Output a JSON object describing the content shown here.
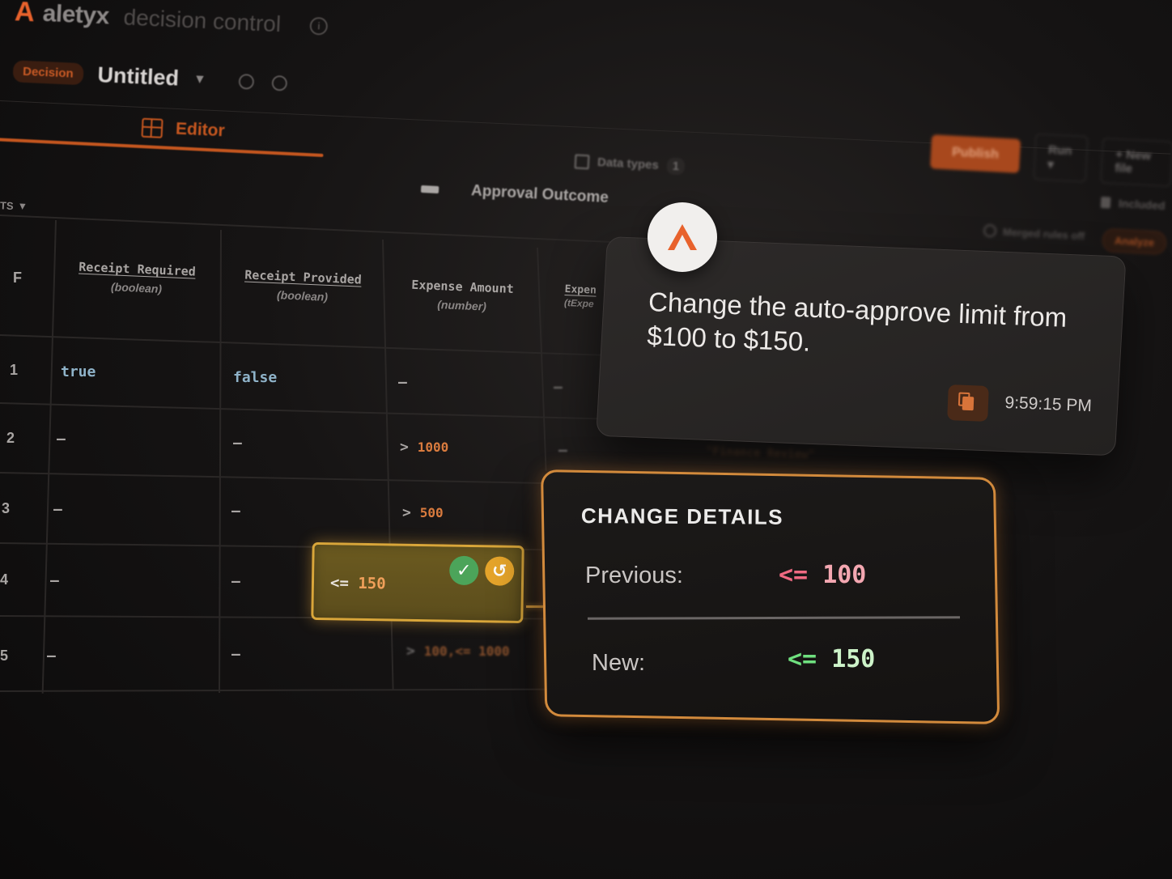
{
  "app": {
    "logo": "A",
    "brand_name": "aletyx",
    "brand_sub": "decision control",
    "info_icon": "info-icon"
  },
  "header": {
    "badge": "Decision",
    "title": "Untitled",
    "tab_editor": "Editor",
    "data_types_label": "Data types",
    "data_types_count": "1",
    "publish_label": "Publish",
    "run_label": "Run",
    "new_file_label": "New file",
    "included_label": "Included",
    "hit_policy_label": "Merged rules off",
    "analyze_label": "Analyze"
  },
  "table": {
    "inputs_toggle": "TS",
    "output_title": "Approval Outcome",
    "hit_col": "F",
    "columns": [
      {
        "name": "Receipt Required",
        "type": "(boolean)"
      },
      {
        "name": "Receipt Provided",
        "type": "(boolean)"
      },
      {
        "name": "Expense Amount",
        "type": "(number)"
      },
      {
        "name": "Expen",
        "type": "(tExpe"
      }
    ],
    "rows": [
      {
        "num": "1",
        "c1": "true",
        "c2": "false",
        "c3_op": "",
        "c3_num": "–",
        "c4": "–"
      },
      {
        "num": "2",
        "c1": "–",
        "c2": "–",
        "c3_op": ">",
        "c3_num": "1000",
        "c4": "–"
      },
      {
        "num": "3",
        "c1": "–",
        "c2": "–",
        "c3_op": ">",
        "c3_num": "500",
        "c4": ""
      },
      {
        "num": "4",
        "c1": "–",
        "c2": "–",
        "c3_op": "",
        "c3_num": "",
        "c4": ""
      },
      {
        "num": "5",
        "c1": "–",
        "c2": "–",
        "c3_op": ">",
        "c3_num": "100,<= 1000",
        "c4": ""
      }
    ],
    "faded_output": "\"Finance Review\""
  },
  "edit_cell": {
    "op": "<=",
    "value": "150",
    "accept_icon": "check-icon",
    "undo_icon": "undo-icon"
  },
  "message": {
    "text": "Change the auto-approve limit from $100 to $150.",
    "time": "9:59:15 PM",
    "avatar_logo": "A"
  },
  "change_details": {
    "title": "CHANGE DETAILS",
    "previous_label": "Previous:",
    "previous_op": "<=",
    "previous_value": "100",
    "new_label": "New:",
    "new_op": "<=",
    "new_value": "150"
  },
  "colors": {
    "accent": "#e8622c",
    "edit_border": "#d9a63a",
    "old_value": "#f06a82",
    "new_value": "#6fe07f"
  }
}
